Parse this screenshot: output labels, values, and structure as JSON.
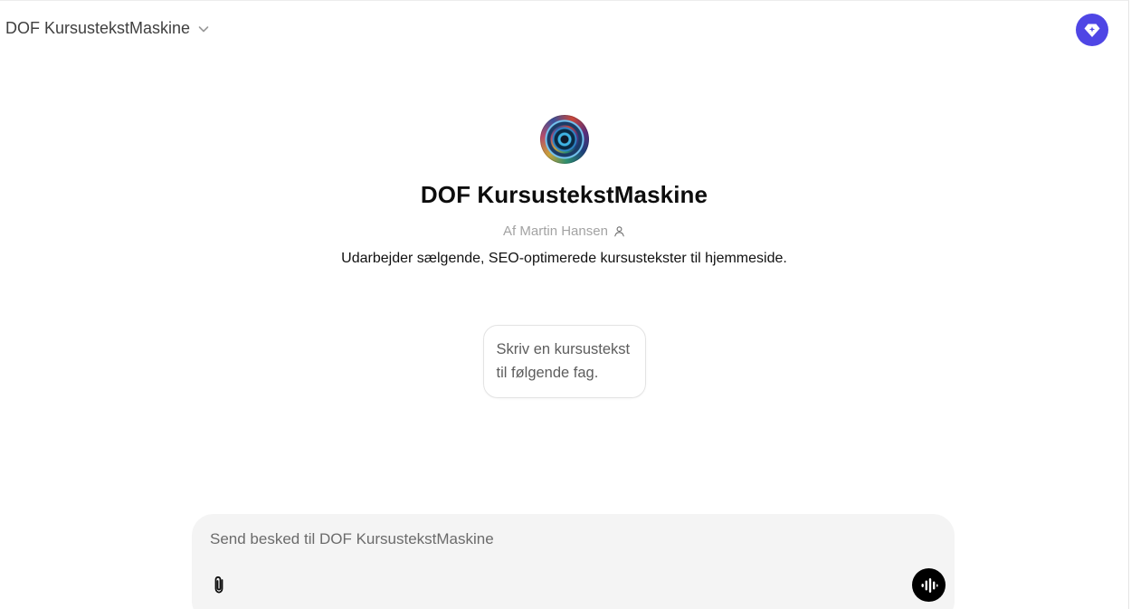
{
  "header": {
    "model_name": "DOF KursustekstMaskine",
    "model_icon": "chevron-down-icon",
    "upgrade_icon": "diamond-sparkle-icon",
    "upgrade_color": "#4f46e5"
  },
  "gpt": {
    "avatar_icon": "gpt-avatar-image",
    "title": "DOF KursustekstMaskine",
    "author": "Af Martin Hansen",
    "author_icon": "person-icon",
    "description": "Udarbejder sælgende, SEO-optimerede kursustekster til hjemmeside."
  },
  "conversation_starters": [
    {
      "label": "Skriv en kursustekst til følgende fag."
    }
  ],
  "composer": {
    "value": "",
    "placeholder": "Send besked til DOF KursustekstMaskine",
    "attach_icon": "paperclip-icon",
    "voice_icon": "voice-waveform-icon"
  }
}
